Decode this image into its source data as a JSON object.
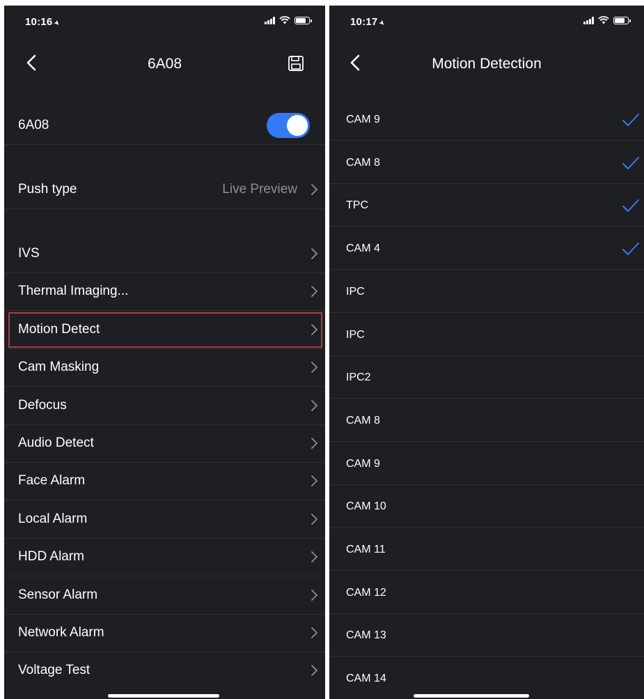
{
  "left": {
    "status": {
      "time": "10:16",
      "location_icon": "location-arrow-icon"
    },
    "nav": {
      "title": "6A08",
      "back_icon": "chevron-left-icon",
      "save_icon": "save-icon"
    },
    "device_toggle": {
      "label": "6A08",
      "enabled": true
    },
    "push_type": {
      "label": "Push type",
      "value": "Live Preview"
    },
    "items": [
      {
        "label": "IVS"
      },
      {
        "label": "Thermal Imaging..."
      },
      {
        "label": "Motion Detect"
      },
      {
        "label": "Cam Masking"
      },
      {
        "label": "Defocus"
      },
      {
        "label": "Audio Detect"
      },
      {
        "label": "Face Alarm"
      },
      {
        "label": "Local Alarm"
      },
      {
        "label": "HDD Alarm"
      },
      {
        "label": "Sensor Alarm"
      },
      {
        "label": "Network Alarm"
      },
      {
        "label": "Voltage Test"
      }
    ]
  },
  "right": {
    "status": {
      "time": "10:17",
      "location_icon": "location-arrow-icon"
    },
    "nav": {
      "title": "Motion Detection",
      "back_icon": "chevron-left-icon"
    },
    "channels": [
      {
        "label": "CAM 9",
        "checked": true
      },
      {
        "label": "CAM 8",
        "checked": true
      },
      {
        "label": "TPC",
        "checked": true
      },
      {
        "label": "CAM 4",
        "checked": true
      },
      {
        "label": "IPC",
        "checked": false
      },
      {
        "label": "IPC",
        "checked": false
      },
      {
        "label": "IPC2",
        "checked": false
      },
      {
        "label": "CAM 8",
        "checked": false
      },
      {
        "label": "CAM 9",
        "checked": false
      },
      {
        "label": "CAM 10",
        "checked": false
      },
      {
        "label": "CAM 11",
        "checked": false
      },
      {
        "label": "CAM 12",
        "checked": false
      },
      {
        "label": "CAM 13",
        "checked": false
      },
      {
        "label": "CAM 14",
        "checked": false
      }
    ]
  },
  "colors": {
    "background": "#1e1f23",
    "accent": "#3479f6",
    "highlight_border": "#b23a3a",
    "secondary_text": "#8e8e93"
  }
}
